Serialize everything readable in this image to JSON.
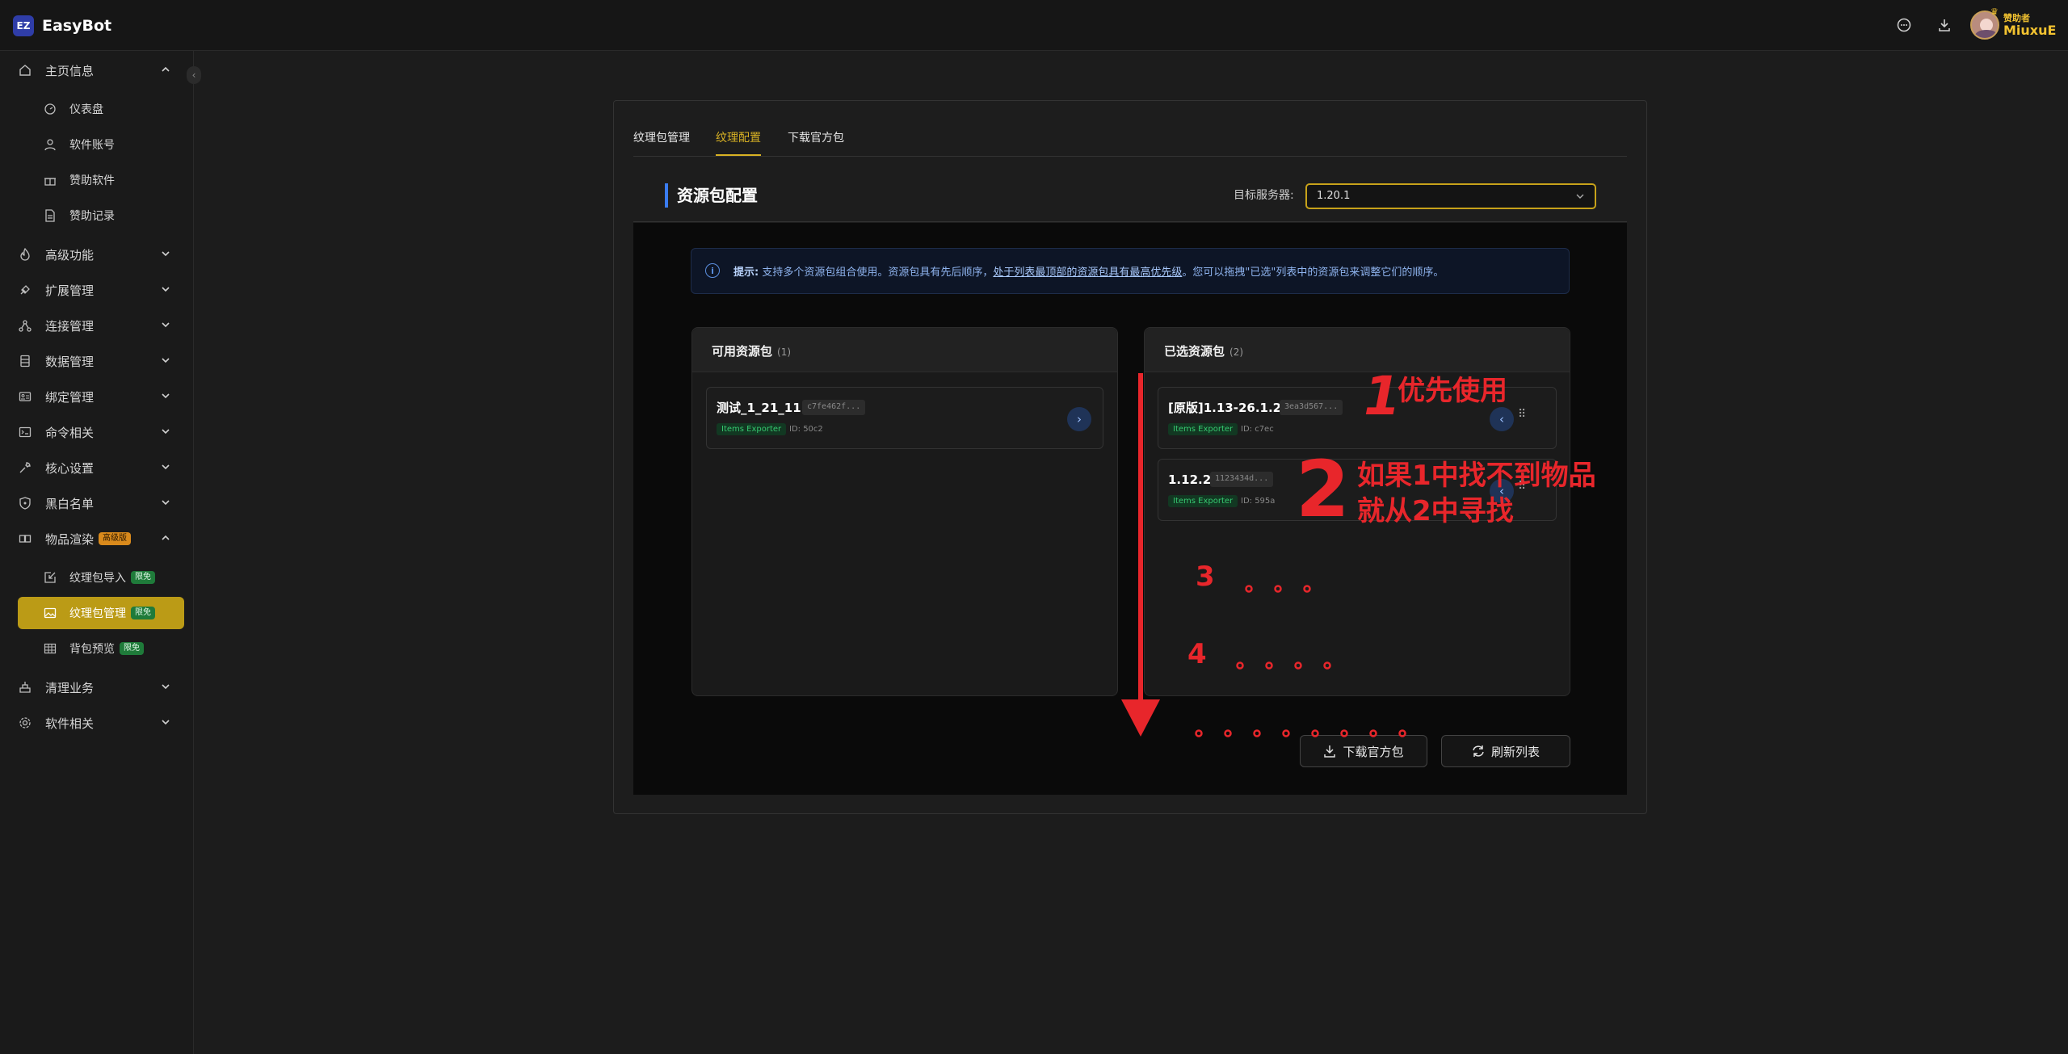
{
  "app": {
    "logo_text": "EZ",
    "name": "EasyBot"
  },
  "topbar": {
    "icons": [
      "chat-icon",
      "download-icon"
    ],
    "user": {
      "badge": "赞助者",
      "name": "MiuxuE"
    }
  },
  "sidebar": {
    "collapse_icon": "‹",
    "items": [
      {
        "label": "主页信息",
        "icon": "home-icon",
        "expanded": true
      },
      {
        "label": "仪表盘",
        "icon": "gauge-icon"
      },
      {
        "label": "软件账号",
        "icon": "user-icon"
      },
      {
        "label": "赞助软件",
        "icon": "gift-icon"
      },
      {
        "label": "赞助记录",
        "icon": "document-icon"
      },
      {
        "label": "高级功能",
        "icon": "flame-icon"
      },
      {
        "label": "扩展管理",
        "icon": "puzzle-icon"
      },
      {
        "label": "连接管理",
        "icon": "network-icon"
      },
      {
        "label": "数据管理",
        "icon": "database-icon"
      },
      {
        "label": "绑定管理",
        "icon": "id-card-icon"
      },
      {
        "label": "命令相关",
        "icon": "terminal-icon"
      },
      {
        "label": "核心设置",
        "icon": "wrench-icon"
      },
      {
        "label": "黑白名单",
        "icon": "shield-icon"
      },
      {
        "label": "物品渲染",
        "icon": "cube-icon",
        "badge": "高级版",
        "expanded": true
      },
      {
        "label": "纹理包导入",
        "icon": "import-icon",
        "badge": "限免"
      },
      {
        "label": "纹理包管理",
        "icon": "image-icon",
        "badge": "限免",
        "active": true
      },
      {
        "label": "背包预览",
        "icon": "grid-icon",
        "badge": "限免"
      },
      {
        "label": "清理业务",
        "icon": "broom-icon"
      },
      {
        "label": "软件相关",
        "icon": "gear-icon"
      }
    ]
  },
  "tabs": [
    {
      "label": "纹理包管理"
    },
    {
      "label": "纹理配置",
      "active": true
    },
    {
      "label": "下载官方包"
    }
  ],
  "config": {
    "title": "资源包配置",
    "target_label": "目标服务器:",
    "target_value": "1.20.1"
  },
  "tip": {
    "label": "提示:",
    "text1": "支持多个资源包组合使用。资源包具有先后顺序，",
    "link": "处于列表最顶部的资源包具有最高优先级",
    "text2": "。您可以拖拽\"已选\"列表中的资源包来调整它们的顺序。"
  },
  "available": {
    "title": "可用资源包",
    "count": "(1)",
    "items": [
      {
        "name": "测试_1_21_11",
        "hash": "c7fe462f...",
        "tag": "Items Exporter",
        "id": "ID: 50c2"
      }
    ]
  },
  "selected": {
    "title": "已选资源包",
    "count": "(2)",
    "items": [
      {
        "name": "[原版]1.13-26.1.2",
        "hash": "3ea3d567...",
        "tag": "Items Exporter",
        "id": "ID: c7ec"
      },
      {
        "name": "1.12.2",
        "hash": "1123434d...",
        "tag": "Items Exporter",
        "id": "ID: 595a"
      }
    ]
  },
  "buttons": {
    "download": "下载官方包",
    "refresh": "刷新列表"
  },
  "annotations": {
    "n1": "1",
    "t1": "优先使用",
    "n2": "2",
    "t2a": "如果1中找不到物品",
    "t2b": "就从2中寻找",
    "n3": "3",
    "n4": "4",
    "color": "#e8262b"
  }
}
